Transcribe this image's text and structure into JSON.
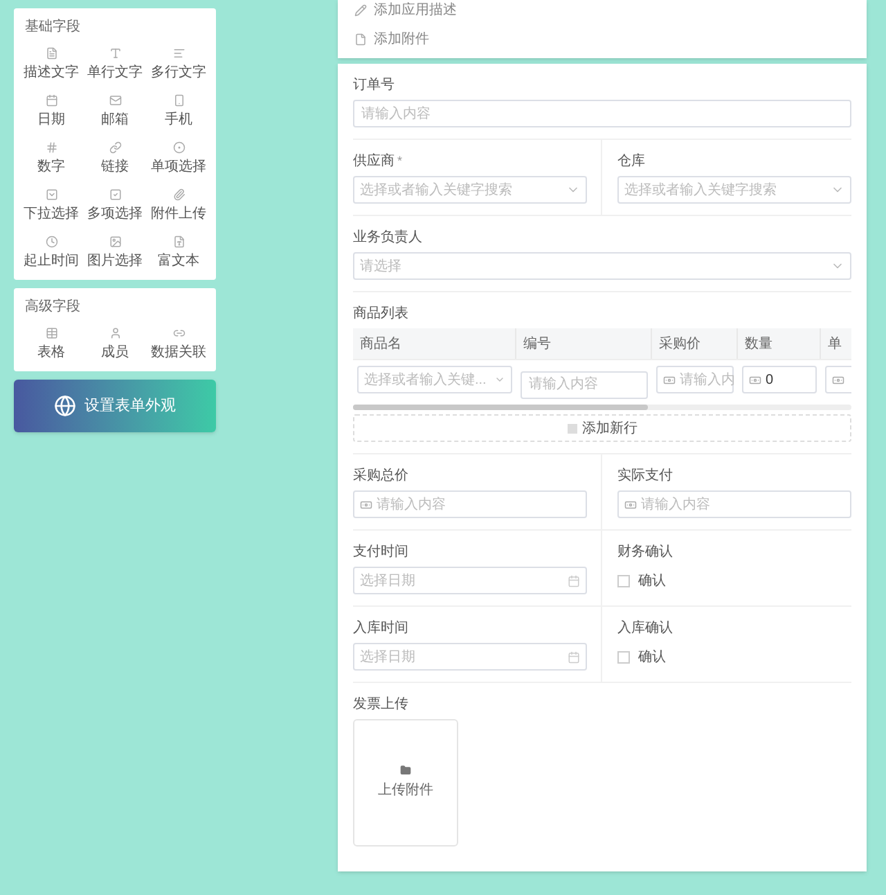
{
  "basic_fields": {
    "title": "基础字段",
    "items": [
      {
        "label": "描述文字"
      },
      {
        "label": "单行文字"
      },
      {
        "label": "多行文字"
      },
      {
        "label": "日期"
      },
      {
        "label": "邮箱"
      },
      {
        "label": "手机"
      },
      {
        "label": "数字"
      },
      {
        "label": "链接"
      },
      {
        "label": "单项选择"
      },
      {
        "label": "下拉选择"
      },
      {
        "label": "多项选择"
      },
      {
        "label": "附件上传"
      },
      {
        "label": "起止时间"
      },
      {
        "label": "图片选择"
      },
      {
        "label": "富文本"
      }
    ]
  },
  "advanced_fields": {
    "title": "高级字段",
    "items": [
      {
        "label": "表格"
      },
      {
        "label": "成员"
      },
      {
        "label": "数据关联"
      }
    ]
  },
  "appearance_button": {
    "label": "设置表单外观"
  },
  "header_card": {
    "actions": [
      {
        "kind": "description",
        "label": "添加应用描述"
      },
      {
        "kind": "attachment",
        "label": "添加附件"
      }
    ]
  },
  "form": {
    "rows": [
      [
        {
          "kind": "input",
          "label": "订单号",
          "placeholder": "请输入内容"
        }
      ],
      [
        {
          "kind": "select",
          "label": "供应商",
          "required_mark": "*",
          "placeholder": "选择或者输入关键字搜索"
        },
        {
          "kind": "select",
          "label": "仓库",
          "placeholder": "选择或者输入关键字搜索"
        }
      ],
      [
        {
          "kind": "select",
          "label": "业务负责人",
          "placeholder": "请选择"
        }
      ],
      [
        {
          "kind": "table",
          "label": "商品列表",
          "columns": [
            "商品名",
            "编号",
            "采购价",
            "数量",
            "单"
          ],
          "cells": [
            {
              "kind": "select",
              "placeholder": "选择或者输入关键..."
            },
            {
              "kind": "input",
              "placeholder": "请输入内容"
            },
            {
              "kind": "currency",
              "placeholder": "请输入内"
            },
            {
              "kind": "currency",
              "value": "0"
            },
            {
              "kind": "currency"
            }
          ],
          "add_row": "添加新行"
        }
      ],
      [
        {
          "kind": "currency",
          "label": "采购总价",
          "placeholder": "请输入内容"
        },
        {
          "kind": "currency",
          "label": "实际支付",
          "placeholder": "请输入内容"
        }
      ],
      [
        {
          "kind": "date",
          "label": "支付时间",
          "placeholder": "选择日期"
        },
        {
          "kind": "checkbox",
          "label": "财务确认",
          "option": "确认",
          "checked": false
        }
      ],
      [
        {
          "kind": "date",
          "label": "入库时间",
          "placeholder": "选择日期"
        },
        {
          "kind": "checkbox",
          "label": "入库确认",
          "option": "确认",
          "checked": false
        }
      ],
      [
        {
          "kind": "upload",
          "label": "发票上传",
          "button": "上传附件"
        }
      ]
    ]
  }
}
